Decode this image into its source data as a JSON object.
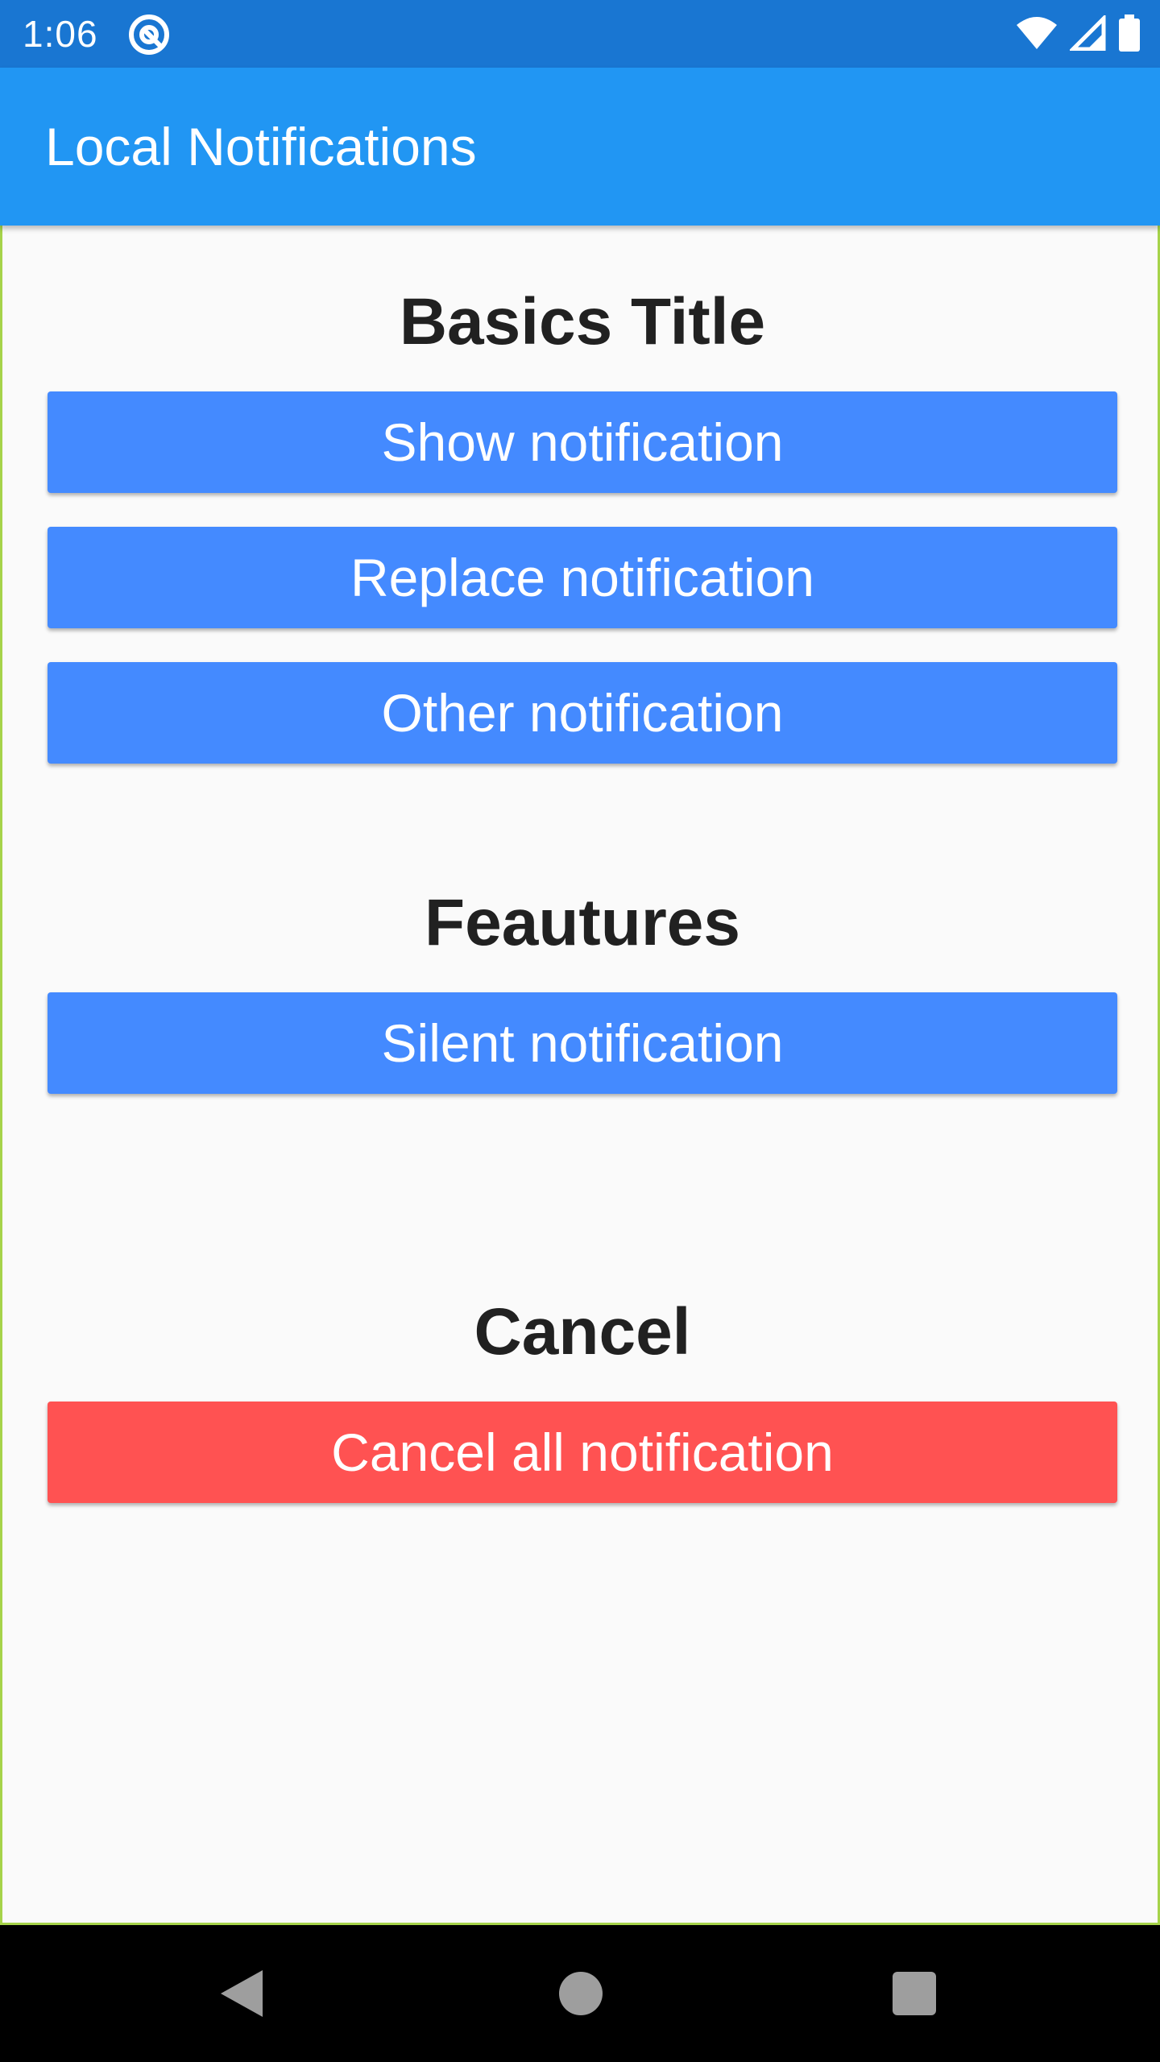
{
  "status_bar": {
    "time": "1:06",
    "icons": [
      "app-notification-icon",
      "wifi-icon",
      "signal-icon",
      "battery-icon"
    ]
  },
  "app_bar": {
    "title": "Local Notifications"
  },
  "sections": {
    "basics": {
      "title": "Basics Title",
      "buttons": {
        "show": "Show notification",
        "replace": "Replace notification",
        "other": "Other notification"
      }
    },
    "features": {
      "title": "Feautures",
      "buttons": {
        "silent": "Silent notification"
      }
    },
    "cancel": {
      "title": "Cancel",
      "buttons": {
        "cancel_all": "Cancel all notification"
      }
    }
  },
  "nav_bar": {
    "icons": [
      "back-icon",
      "home-icon",
      "recents-icon"
    ]
  },
  "colors": {
    "status_bar": "#1976d2",
    "app_bar": "#2196f3",
    "button_primary": "#448aff",
    "button_danger": "#ff5252",
    "background": "#fafafa",
    "title_text": "#212121"
  }
}
